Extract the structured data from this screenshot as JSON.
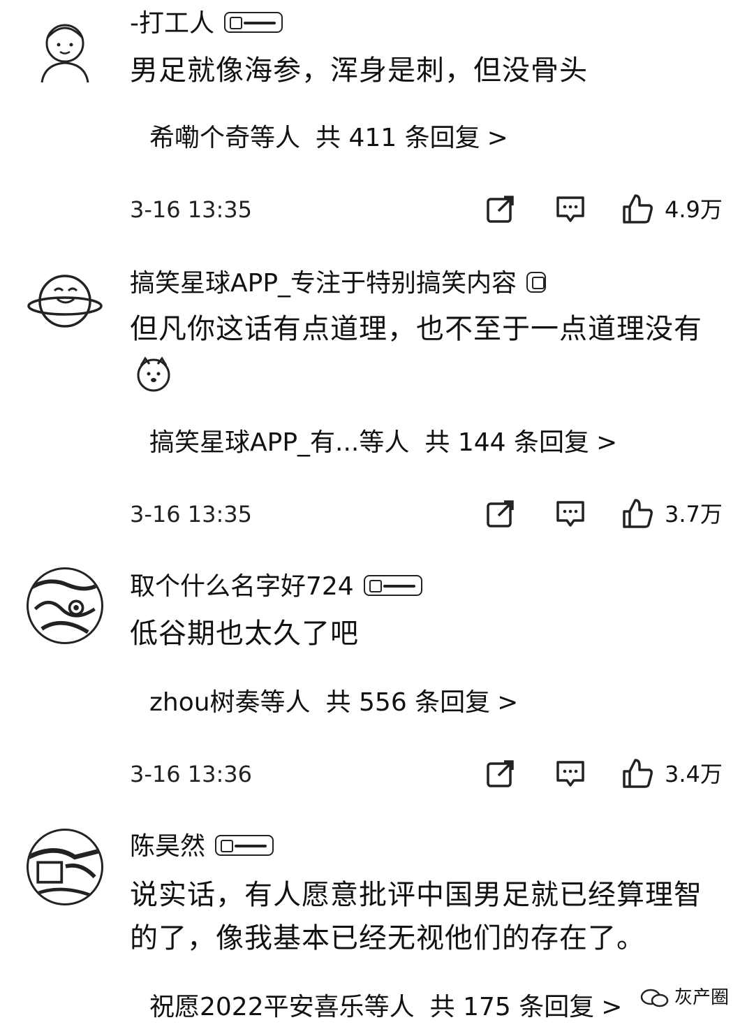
{
  "comments": [
    {
      "username": "-打工人",
      "text": "男足就像海参，浑身是刺，但没骨头",
      "reply_users": "希嘞个奇等人",
      "reply_count": "共 411 条回复",
      "reply_chevron": ">",
      "time": "3-16 13:35",
      "likes": "4.9万",
      "avatar_icon": "cartoon-worker-avatar-icon"
    },
    {
      "username": "搞笑星球APP_专注于特别搞笑内容",
      "text": "但凡你这话有点道理，也不至于一点道理没有",
      "reply_users": "搞笑星球APP_有...等人",
      "reply_count": "共 144 条回复",
      "reply_chevron": ">",
      "time": "3-16 13:35",
      "likes": "3.7万",
      "avatar_icon": "planet-avatar-icon"
    },
    {
      "username": "取个什么名字好724",
      "text": "低谷期也太久了吧",
      "reply_users": "zhou树奏等人",
      "reply_count": "共 556 条回复",
      "reply_chevron": ">",
      "time": "3-16 13:36",
      "likes": "3.4万",
      "avatar_icon": "anime-avatar-icon"
    },
    {
      "username": "陈昊然",
      "text": "说实话，有人愿意批评中国男足就已经算理智的了，像我基本已经无视他们的存在了。",
      "reply_users": "祝愿2022平安喜乐等人",
      "reply_count": "共 175 条回复",
      "reply_chevron": ">",
      "avatar_icon": "photo-avatar-icon"
    }
  ],
  "watermark": "灰产圈",
  "colors": {
    "text": "#111111",
    "background": "#ffffff"
  }
}
